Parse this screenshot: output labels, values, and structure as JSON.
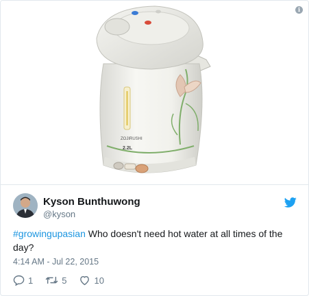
{
  "tweet": {
    "author_name": "Kyson Bunthuwong",
    "author_handle": "@kyson",
    "hashtag": "#growingupasian",
    "text": " Who doesn't need hot water at all times of the day?",
    "timestamp": "4:14 AM - Jul 22, 2015",
    "replies": "1",
    "retweets": "5",
    "likes": "10"
  },
  "media": {
    "subject": "electric hot water dispenser pot",
    "capacity_label": "2.2L",
    "brand_label": "ZOJIRUSHI"
  },
  "icons": {
    "info": "info-icon",
    "bird": "twitter-bird-icon",
    "reply": "reply-icon",
    "retweet": "retweet-icon",
    "like": "heart-icon"
  },
  "colors": {
    "link_blue": "#1b95e0",
    "twitter_blue": "#1da1f2",
    "muted": "#657786",
    "border": "#e1e8ed"
  }
}
